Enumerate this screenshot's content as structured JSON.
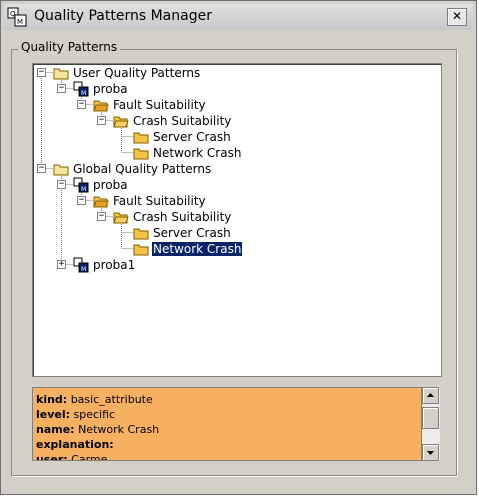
{
  "window": {
    "title": "Quality Patterns Manager",
    "close_glyph": "✕"
  },
  "group": {
    "label": "Quality Patterns"
  },
  "tree": {
    "user_root": "User Quality Patterns",
    "user_proba": "proba",
    "user_fault": "Fault Suitability",
    "user_crash": "Crash Suitability",
    "user_server": "Server Crash",
    "user_network": "Network Crash",
    "global_root": "Global Quality Patterns",
    "global_proba": "proba",
    "global_fault": "Fault Suitability",
    "global_crash": "Crash Suitability",
    "global_server": "Server Crash",
    "global_network": "Network Crash",
    "global_proba1": "proba1",
    "selected": "global_network"
  },
  "info": {
    "kind_key": "kind:",
    "kind_val": "basic_attribute",
    "level_key": "level:",
    "level_val": "specific",
    "name_key": "name:",
    "name_val": "Network Crash",
    "explanation_key": "explanation:",
    "explanation_val": "",
    "user_key": "user:",
    "user_val": "Carme"
  },
  "colors": {
    "info_bg": "#f7b060",
    "selection": "#0a246a",
    "folder": "#f5c542"
  },
  "icons": {
    "close": "close-icon",
    "folder": "folder-icon",
    "pattern": "pattern-icon"
  }
}
